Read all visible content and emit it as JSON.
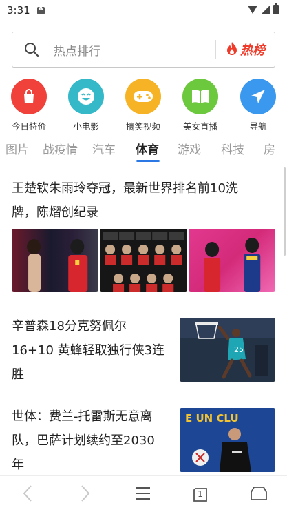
{
  "status_bar": {
    "time": "3:31"
  },
  "search": {
    "placeholder": "热点排行",
    "hot_label": "热榜"
  },
  "quick_links": [
    {
      "label": "今日特价",
      "icon": "shopping-bag-icon",
      "color": "#f0413a"
    },
    {
      "label": "小电影",
      "icon": "smiley-icon",
      "color": "#35b9c9"
    },
    {
      "label": "搞笑视频",
      "icon": "gamepad-icon",
      "color": "#f6b326"
    },
    {
      "label": "美女直播",
      "icon": "book-icon",
      "color": "#6cc83c"
    },
    {
      "label": "导航",
      "icon": "paper-plane-icon",
      "color": "#3a98ef"
    }
  ],
  "tabs": [
    "图片",
    "战疫情",
    "汽车",
    "体育",
    "游戏",
    "科技",
    "房"
  ],
  "active_tab": "体育",
  "articles": [
    {
      "title_lines": [
        "王楚钦朱雨玲夺冠，最新世界排名前10洗",
        "牌，陈熠创纪录"
      ]
    },
    {
      "title_lines": [
        "辛普森18分克努佩尔",
        "16+10 黄蜂轻取独行侠3连",
        "胜"
      ]
    },
    {
      "title_lines": [
        "世体：费兰-托雷斯无意离",
        "队，巴萨计划续约至2030",
        "年"
      ]
    }
  ],
  "bottom_nav": {
    "back": "back-icon",
    "forward": "forward-icon",
    "menu": "menu-icon",
    "tabs_count": "1",
    "home": "home-icon"
  },
  "colors": {
    "accent": "#2b78e4",
    "hot": "#ee3b2a"
  }
}
